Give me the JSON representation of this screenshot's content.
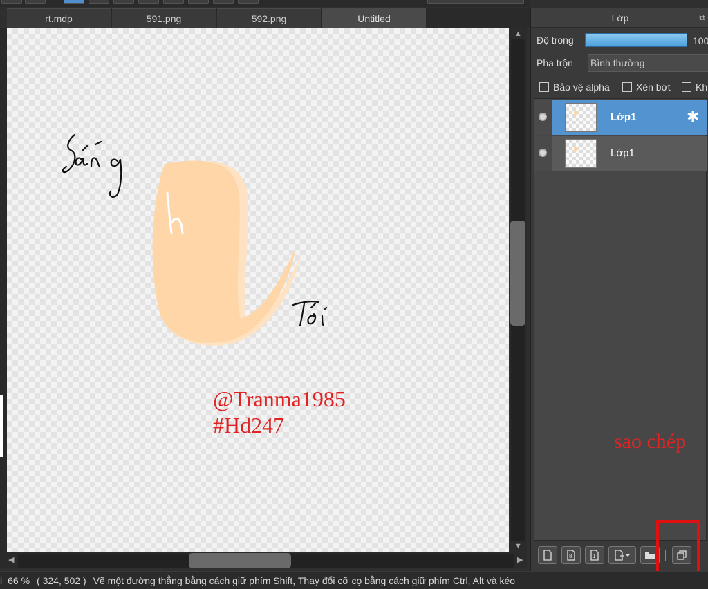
{
  "tabs": [
    {
      "label": "rt.mdp",
      "active": false
    },
    {
      "label": "591.png",
      "active": false
    },
    {
      "label": "592.png",
      "active": false
    },
    {
      "label": "Untitled",
      "active": true
    }
  ],
  "canvas": {
    "handwriting": [
      "Sáng",
      "h",
      "Tối"
    ],
    "annotation_line1": "@Tranma1985",
    "annotation_line2": "#Hd247",
    "colors": {
      "stroke_main": "#ffd6a8",
      "stroke_light": "#ffe4c4",
      "ink": "#111111",
      "annotation": "#e02424"
    }
  },
  "panel": {
    "title": "Lớp",
    "opacity_label": "Độ trong",
    "opacity_value": "100",
    "opacity_level": 1.0,
    "blend_label": "Pha trộn",
    "blend_value": "Bình thường",
    "checkboxes": [
      {
        "label": "Bảo vệ alpha",
        "checked": false
      },
      {
        "label": "Xén bớt",
        "checked": false
      },
      {
        "label": "Kh",
        "checked": false
      }
    ],
    "layers": [
      {
        "name": "Lớp1",
        "selected": true,
        "visible": true
      },
      {
        "name": "Lớp1",
        "selected": false,
        "visible": true
      }
    ],
    "copy_annotation": "sao chép",
    "toolbar_icons": [
      "new-layer-icon",
      "new-8bit-layer-icon",
      "new-1bit-layer-icon",
      "add-layer-dropdown-icon",
      "folder-icon",
      "duplicate-layer-icon"
    ]
  },
  "status": {
    "zoom": "66 %",
    "coords": "( 324, 502 )",
    "hint": "Vẽ một đường thẳng bằng cách giữ phím Shift, Thay đổi cỡ cọ bằng cách giữ phím Ctrl, Alt và kéo"
  }
}
